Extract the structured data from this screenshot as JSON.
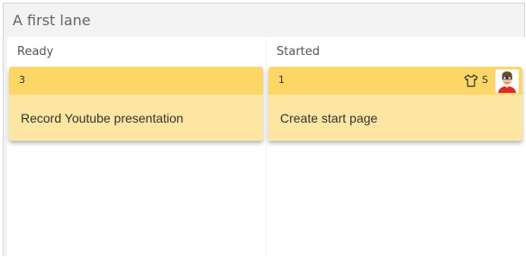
{
  "lane": {
    "title": "A first lane"
  },
  "columns": [
    {
      "title": "Ready",
      "cards": [
        {
          "id": "3",
          "title": "Record Youtube presentation"
        }
      ]
    },
    {
      "title": "Started",
      "cards": [
        {
          "id": "1",
          "title": "Create start page",
          "size": "S",
          "size_icon": "tshirt-icon",
          "assignee_icon": "avatar-superhero-icon"
        }
      ]
    }
  ],
  "colors": {
    "card_header": "#fcd768",
    "card_body": "#fde6a2",
    "lane_background": "#f3f3f3"
  }
}
